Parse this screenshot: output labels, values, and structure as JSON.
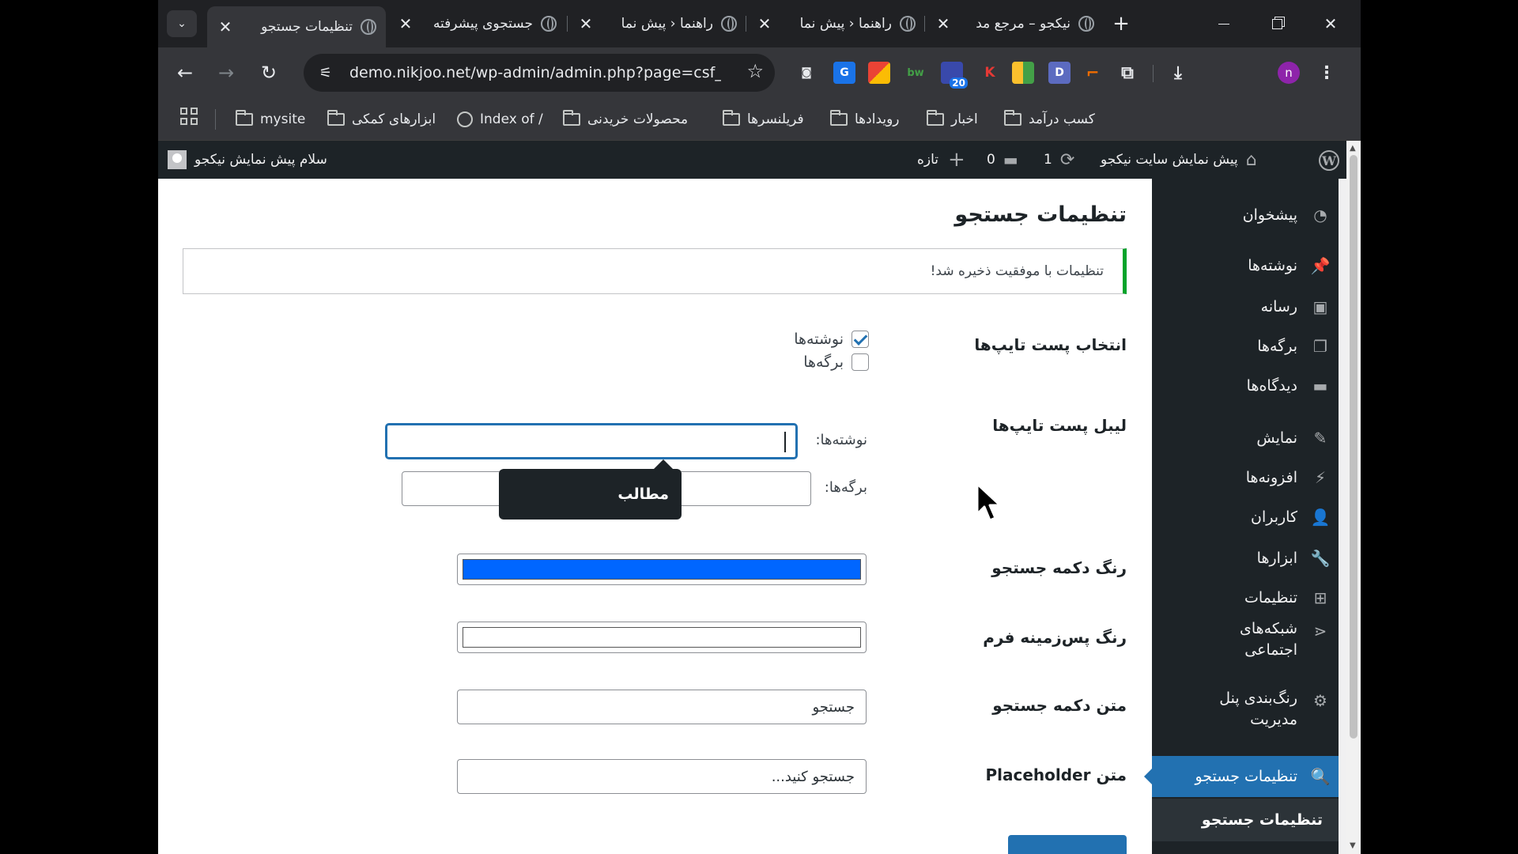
{
  "browser": {
    "tabs": [
      {
        "title": "تنظیمات جستجو",
        "active": true
      },
      {
        "title": "جستجوی پیشرفته",
        "active": false
      },
      {
        "title": "راهنما ‹ پیش نما",
        "active": false
      },
      {
        "title": "راهنما ‹ پیش نما",
        "active": false
      },
      {
        "title": "نیکجو – مرجع مد",
        "active": false
      }
    ],
    "tab_close_glyph": "✕",
    "new_tab_glyph": "+",
    "url": "demo.nikjoo.net/wp-admin/admin.php?page=csf_...",
    "profile_initial": "n",
    "extension_badge": "20",
    "extensions": [
      {
        "icon": "camera-icon",
        "color": "#5f6368",
        "label": "📷"
      },
      {
        "icon": "translate-icon",
        "color": "#1a73e8",
        "label": "G"
      },
      {
        "icon": "office-icon",
        "color": "#ea4335",
        "label": "■"
      },
      {
        "icon": "bw-icon",
        "color": "#2e7d32",
        "label": "bw"
      },
      {
        "icon": "badge-ext-icon",
        "color": "#3949ab",
        "label": "◆"
      },
      {
        "icon": "k-icon",
        "color": "#c62828",
        "label": "K"
      },
      {
        "icon": "color-ext-icon",
        "color": "#f9a825",
        "label": "▦"
      },
      {
        "icon": "d-icon",
        "color": "#5c6bc0",
        "label": "D"
      },
      {
        "icon": "f-ext-icon",
        "color": "#ef6c00",
        "label": "F"
      }
    ]
  },
  "bookmarks": [
    {
      "label": "mysite",
      "type": "folder"
    },
    {
      "label": "ابزارهای کمکی",
      "type": "folder"
    },
    {
      "label": "Index of /",
      "type": "globe"
    },
    {
      "label": "محصولات خریدنی",
      "type": "folder"
    },
    {
      "label": "فریلنسرها",
      "type": "folder"
    },
    {
      "label": "رویدادها",
      "type": "folder"
    },
    {
      "label": "اخبار",
      "type": "folder"
    },
    {
      "label": "کسب درآمد",
      "type": "folder"
    }
  ],
  "adminbar": {
    "site_name": "پیش نمایش سایت نیکجو",
    "updates": "1",
    "comments": "0",
    "new_label": "تازه",
    "greeting": "سلام پیش نمایش نیکجو"
  },
  "menu": [
    {
      "label": "پیشخوان",
      "icon": "dashboard-icon",
      "glyph": "◔"
    },
    {
      "label": "نوشته‌ها",
      "icon": "pin-icon",
      "glyph": "📌"
    },
    {
      "label": "رسانه",
      "icon": "media-icon",
      "glyph": "▣"
    },
    {
      "label": "برگه‌ها",
      "icon": "pages-icon",
      "glyph": "❐"
    },
    {
      "label": "دیدگاه‌ها",
      "icon": "comments-icon",
      "glyph": "▬"
    },
    {
      "label": "نمایش",
      "icon": "appearance-icon",
      "glyph": "✎"
    },
    {
      "label": "افزونه‌ها",
      "icon": "plugins-icon",
      "glyph": "⚡"
    },
    {
      "label": "کاربران",
      "icon": "users-icon",
      "glyph": "👤"
    },
    {
      "label": "ابزارها",
      "icon": "tools-icon",
      "glyph": "🔧"
    },
    {
      "label": "تنظیمات",
      "icon": "settings-icon",
      "glyph": "⊞"
    },
    {
      "label": "شبکه‌های اجتماعی",
      "icon": "share-icon",
      "glyph": "⋖"
    },
    {
      "label": "رنگ‌بندی پنل مدیریت",
      "icon": "gear-icon",
      "glyph": "⚙"
    },
    {
      "label": "تنظیمات جستجو",
      "icon": "search-icon",
      "glyph": "🔍",
      "current": true
    }
  ],
  "submenu": {
    "label": "تنظیمات جستجو"
  },
  "page": {
    "title": "تنظیمات جستجو",
    "notice": "تنظیمات با موفقیت ذخیره شد!",
    "post_types_label": "انتخاب پست تایپ‌ها",
    "post_types": [
      {
        "label": "نوشته‌ها",
        "checked": true
      },
      {
        "label": "برگه‌ها",
        "checked": false
      }
    ],
    "labels_label": "لیبل پست تایپ‌ها",
    "posts_field_label": "نوشته‌ها:",
    "posts_field_value": "",
    "pages_field_label": "برگه‌ها:",
    "pages_field_value": "",
    "tooltip": "مطالب",
    "button_color_label": "رنگ دکمه جستجو",
    "button_color": "#0066ff",
    "bg_color_label": "رنگ پس‌زمینه فرم",
    "bg_color": "#ffffff",
    "button_text_label": "متن دکمه جستجو",
    "button_text_value": "جستجو",
    "placeholder_label": "متن Placeholder",
    "placeholder_value": "جستجو کنید..."
  }
}
